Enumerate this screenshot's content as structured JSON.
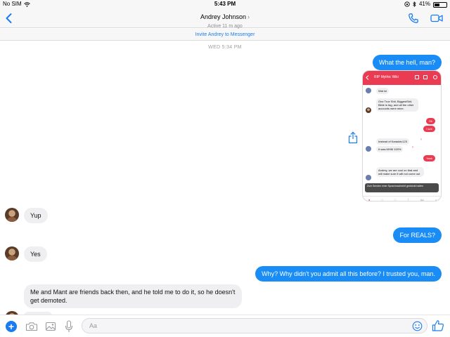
{
  "status": {
    "carrier": "No SIM",
    "time": "5:43 PM",
    "battery": "41%",
    "battery_level": 0.41
  },
  "nav": {
    "contact_name": "Andrey Johnson",
    "active_status": "Active 11 m ago"
  },
  "invite_text": "Invite Andrey to Messenger",
  "day_stamp": "WED 5:34 PM",
  "messages": [
    {
      "dir": "out",
      "text": "What the hell, man?"
    },
    {
      "dir": "in",
      "text": "Yup"
    },
    {
      "dir": "out",
      "text": "For REALS?"
    },
    {
      "dir": "in",
      "text": "Yes"
    },
    {
      "dir": "out",
      "text": "Why? Why didn't you admit all this before? I trusted you, man."
    },
    {
      "dir": "in",
      "text": "Me and Mant are friends back then, and he told me to do it, so he doesn't get demoted."
    }
  ],
  "shared_screenshot": {
    "header_title": "RIP Mythic Wiki",
    "lines": {
      "m1": "Wat lol",
      "m2": "One True Shit, BiggestShit, Bible is fag, and all the other accounts were mine.",
      "r1": "Ok",
      "r2": "I see",
      "m3": "Instead of Karadzic123",
      "m4": "It was MHM 100%",
      "r3": "Yeah",
      "m5": "Andrey, we are cool on that and will make sure it will not come out",
      "toast": "Zum Senden einer Sprachnachricht gedrückt halten"
    }
  },
  "composer": {
    "placeholder": "Aa"
  },
  "colors": {
    "accent": "#1a7cf3",
    "out_bubble": "#1a8cf5",
    "in_bubble": "#efeff1",
    "embedded_header": "#ea3b52"
  }
}
